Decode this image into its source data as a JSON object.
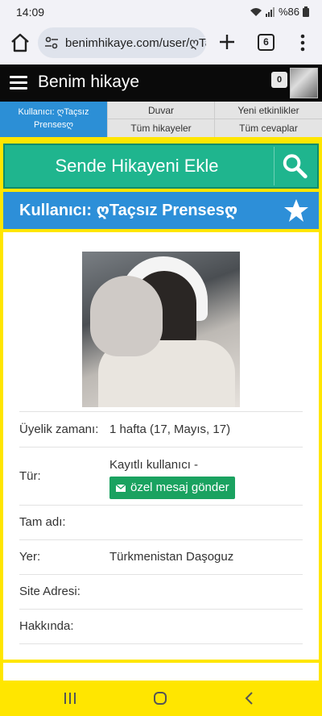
{
  "status_bar": {
    "time": "14:09",
    "battery": "%86"
  },
  "browser": {
    "url": "benimhikaye.com/user/ღTa",
    "tab_count": "6"
  },
  "site": {
    "title": "Benim hikaye",
    "notification_count": "0"
  },
  "nav": {
    "active": "Kullanıcı: ღTaçsız Prensesღ",
    "wall": "Duvar",
    "new_activities": "Yeni etkinlikler",
    "all_stories": "Tüm hikayeler",
    "all_answers": "Tüm cevaplar"
  },
  "add_story": {
    "label": "Sende Hikayeni Ekle"
  },
  "user_bar": {
    "label": "Kullanıcı: ღTaçsız Prensesღ"
  },
  "profile": {
    "member_since_label": "Üyelik zamanı:",
    "member_since_value": "1 hafta (17, Mayıs, 17)",
    "type_label": "Tür:",
    "type_value": "Kayıtlı kullanıcı -",
    "message_button": "özel mesaj gönder",
    "fullname_label": "Tam adı:",
    "fullname_value": "",
    "location_label": "Yer:",
    "location_value": "Türkmenistan Daşoguz",
    "website_label": "Site Adresi:",
    "website_value": "",
    "about_label": "Hakkında:",
    "about_value": ""
  },
  "colors": {
    "page_bg": "#ffe600",
    "add_bar": "#1fb58e",
    "user_bar": "#2d8fd8",
    "nav_active": "#2c8fd6",
    "message_button": "#1aa260"
  }
}
